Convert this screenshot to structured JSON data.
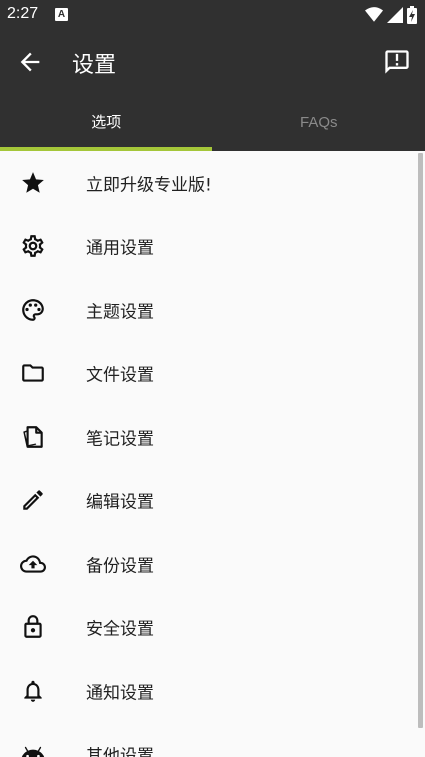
{
  "status_bar": {
    "time": "2:27",
    "notification_letter": "A",
    "icons": [
      "wifi-icon",
      "signal-icon",
      "battery-icon"
    ]
  },
  "app_bar": {
    "title": "设置",
    "back_icon": "arrow-back-icon",
    "action_icon": "feedback-icon"
  },
  "tabs": [
    {
      "label": "选项",
      "active": true
    },
    {
      "label": "FAQs",
      "active": false
    }
  ],
  "settings": [
    {
      "label": "立即升级专业版!",
      "icon": "star-icon"
    },
    {
      "label": "通用设置",
      "icon": "gear-icon"
    },
    {
      "label": "主题设置",
      "icon": "palette-icon"
    },
    {
      "label": "文件设置",
      "icon": "folder-icon"
    },
    {
      "label": "笔记设置",
      "icon": "notes-icon"
    },
    {
      "label": "编辑设置",
      "icon": "pencil-icon"
    },
    {
      "label": "备份设置",
      "icon": "cloud-upload-icon"
    },
    {
      "label": "安全设置",
      "icon": "lock-icon"
    },
    {
      "label": "通知设置",
      "icon": "bell-icon"
    },
    {
      "label": "其他设置",
      "icon": "android-icon"
    }
  ],
  "colors": {
    "bar_background": "#303030",
    "accent": "#a4c639",
    "list_background": "#fafafa",
    "text_primary": "#212121"
  }
}
